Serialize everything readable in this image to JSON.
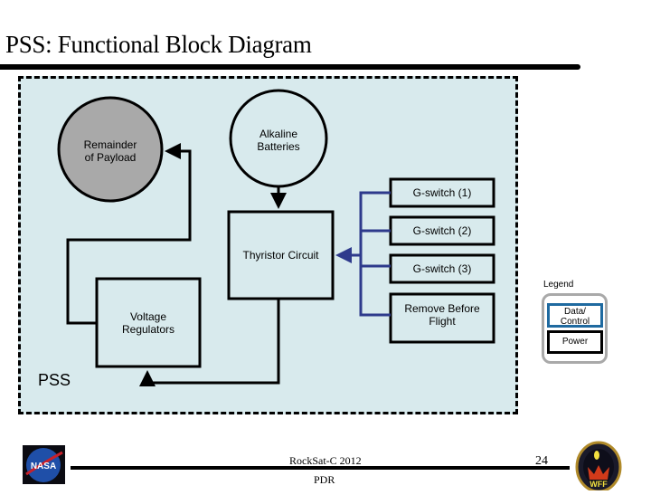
{
  "slide": {
    "title": "PSS: Functional Block Diagram",
    "subsystem_label": "PSS"
  },
  "diagram": {
    "nodes": [
      {
        "id": "payload",
        "label_line1": "Remainder",
        "label_line2": "of Payload",
        "shape": "circle",
        "fill": "#a9a9a9"
      },
      {
        "id": "batteries",
        "label_line1": "Alkaline",
        "label_line2": "Batteries",
        "shape": "circle",
        "fill": "#d8eaed"
      },
      {
        "id": "thyristor",
        "label": "Thyristor Circuit",
        "shape": "box"
      },
      {
        "id": "regulators",
        "label_line1": "Voltage",
        "label_line2": "Regulators",
        "shape": "box"
      },
      {
        "id": "gswitch1",
        "label": "G-switch (1)",
        "shape": "box"
      },
      {
        "id": "gswitch2",
        "label": "G-switch (2)",
        "shape": "box"
      },
      {
        "id": "gswitch3",
        "label": "G-switch (3)",
        "shape": "box"
      },
      {
        "id": "rbf",
        "label_line1": "Remove Before",
        "label_line2": "Flight",
        "shape": "box"
      }
    ],
    "edges": [
      {
        "from": "batteries",
        "to": "thyristor",
        "type": "power"
      },
      {
        "from": "thyristor",
        "to": "regulators",
        "type": "power"
      },
      {
        "from": "regulators",
        "to": "payload",
        "type": "power"
      },
      {
        "from": "gswitch1",
        "to": "thyristor",
        "type": "data"
      },
      {
        "from": "gswitch2",
        "to": "thyristor",
        "type": "data"
      },
      {
        "from": "gswitch3",
        "to": "thyristor",
        "type": "data"
      },
      {
        "from": "rbf",
        "to": "thyristor",
        "type": "data"
      }
    ],
    "colors": {
      "panel_bg": "#d8eaed",
      "power_line": "#000000",
      "data_line": "#2e3a8c",
      "legend_data_border": "#1f6aa0",
      "legend_outline": "#a9a9a9"
    }
  },
  "legend": {
    "title": "Legend",
    "data_line1": "Data/",
    "data_line2": "Control",
    "power": "Power"
  },
  "footer": {
    "event": "RockSat-C 2012",
    "review": "PDR",
    "page_number": "24",
    "left_logo": "NASA",
    "right_logo": "WFF"
  }
}
